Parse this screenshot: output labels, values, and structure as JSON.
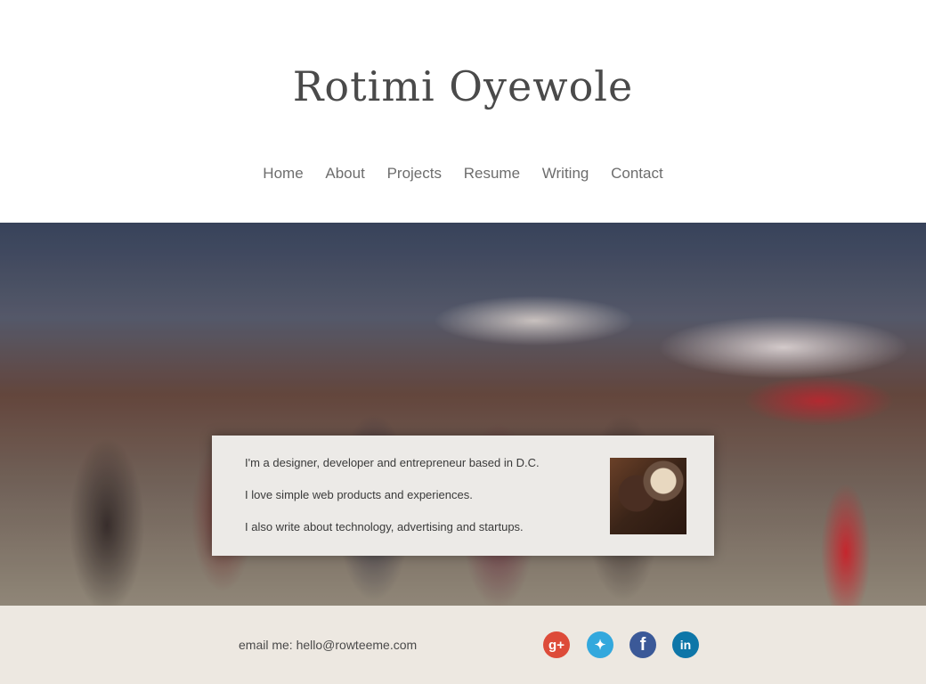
{
  "site": {
    "title": "Rotimi Oyewole"
  },
  "nav": {
    "items": [
      "Home",
      "About",
      "Projects",
      "Resume",
      "Writing",
      "Contact"
    ]
  },
  "intro": {
    "lines": [
      "I'm a designer, developer and entrepreneur based in D.C.",
      "I love simple web products and experiences.",
      "I also write about technology, advertising and startups."
    ]
  },
  "footer": {
    "email_label": "email me:",
    "email": "hello@rowteeme.com",
    "social": [
      {
        "icon": "google-plus-icon",
        "glyph": "g+",
        "color": "#dd4b39"
      },
      {
        "icon": "twitter-icon",
        "glyph": "✦",
        "color": "#33a8dd"
      },
      {
        "icon": "facebook-icon",
        "glyph": "f",
        "color": "#3b5998"
      },
      {
        "icon": "linkedin-icon",
        "glyph": "in",
        "color": "#0e76a8"
      }
    ]
  }
}
